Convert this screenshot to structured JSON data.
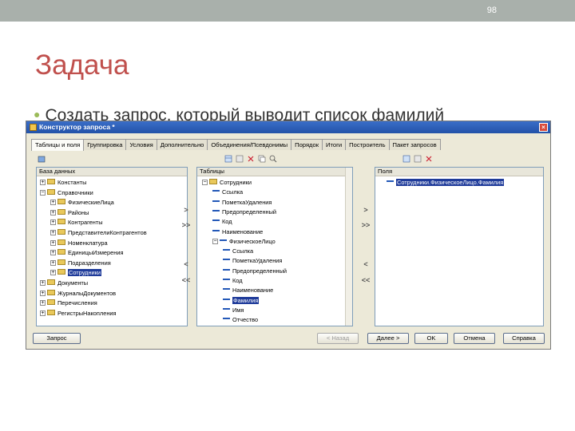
{
  "slide": {
    "page_number": "98",
    "title": "Задача",
    "bullet_text": "Создать запрос, который выводит список фамилий"
  },
  "window": {
    "title": "Конструктор запроса *",
    "close_glyph": "×",
    "tabs": [
      "Таблицы и поля",
      "Группировка",
      "Условия",
      "Дополнительно",
      "Объединения/Псевдонимы",
      "Порядок",
      "Итоги",
      "Построитель",
      "Пакет запросов"
    ],
    "db_panel": {
      "header": "База данных",
      "items": [
        {
          "label": "Константы",
          "pm": "+",
          "icon": "constants-icon"
        },
        {
          "label": "Справочники",
          "pm": "−",
          "icon": "catalogs-icon"
        },
        {
          "label": "ФизическиеЛица",
          "pm": "+",
          "icon": "folder-icon"
        },
        {
          "label": "Районы",
          "pm": "+",
          "icon": "folder-icon"
        },
        {
          "label": "Контрагенты",
          "pm": "+",
          "icon": "folder-icon"
        },
        {
          "label": "ПредставителиКонтрагентов",
          "pm": "+",
          "icon": "folder-icon"
        },
        {
          "label": "Номенклатура",
          "pm": "+",
          "icon": "folder-icon"
        },
        {
          "label": "ЕдиницыИзмерения",
          "pm": "+",
          "icon": "folder-icon"
        },
        {
          "label": "Подразделения",
          "pm": "+",
          "icon": "folder-icon"
        },
        {
          "label": "Сотрудники",
          "pm": "+",
          "icon": "folder-icon",
          "selected": true
        },
        {
          "label": "Документы",
          "pm": "+",
          "icon": "documents-icon"
        },
        {
          "label": "ЖурналыДокументов",
          "pm": "+",
          "icon": "journals-icon"
        },
        {
          "label": "Перечисления",
          "pm": "+",
          "icon": "enums-icon"
        },
        {
          "label": "РегистрыНакопления",
          "pm": "+",
          "icon": "registers-icon"
        }
      ]
    },
    "tables_panel": {
      "header": "Таблицы",
      "items": [
        {
          "label": "Сотрудники",
          "pm": "−"
        },
        {
          "label": "Ссылка"
        },
        {
          "label": "ПометкаУдаления"
        },
        {
          "label": "Предопределенный"
        },
        {
          "label": "Код"
        },
        {
          "label": "Наименование"
        },
        {
          "label": "ФизическоеЛицо",
          "pm": "−"
        },
        {
          "label": "Ссылка"
        },
        {
          "label": "ПометкаУдаления"
        },
        {
          "label": "Предопределенный"
        },
        {
          "label": "Код"
        },
        {
          "label": "Наименование"
        },
        {
          "label": "Фамилия",
          "selected": true
        },
        {
          "label": "Имя"
        },
        {
          "label": "Отчество"
        }
      ]
    },
    "fields_panel": {
      "header": "Поля",
      "items": [
        {
          "label": "Сотрудники.ФизическоеЛицо.Фамилия",
          "selected": true
        }
      ]
    },
    "arrows_left": [
      ">",
      ">>",
      "<",
      "<<"
    ],
    "arrows_right": [
      ">",
      ">>",
      "<",
      "<<"
    ],
    "buttons": {
      "query": "Запрос",
      "back": "< Назад",
      "next": "Далее >",
      "ok": "OK",
      "cancel": "Отмена",
      "help": "Справка"
    }
  }
}
